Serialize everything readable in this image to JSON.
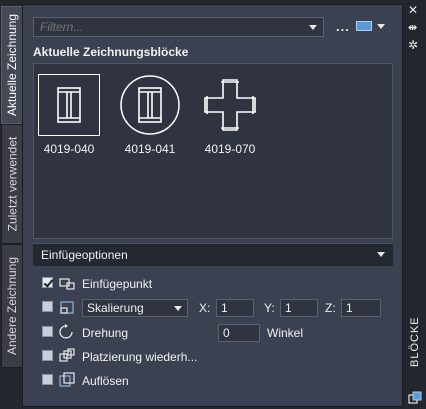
{
  "tabs": [
    {
      "label": "Aktuelle Zeichnung",
      "active": true
    },
    {
      "label": "Zuletzt verwendet",
      "active": false
    },
    {
      "label": "Andere Zeichnung",
      "active": false
    }
  ],
  "filter": {
    "placeholder": "Filtern..."
  },
  "more_label": "...",
  "section_title": "Aktuelle Zeichnungsblöcke",
  "blocks": [
    {
      "label": "4019-040",
      "icon": "i-beam-icon",
      "selected": true
    },
    {
      "label": "4019-041",
      "icon": "i-beam-circle-icon",
      "selected": false
    },
    {
      "label": "4019-070",
      "icon": "cross-icon",
      "selected": false
    }
  ],
  "options": {
    "title": "Einfügeoptionen",
    "insertion_point": {
      "label": "Einfügepunkt",
      "checked": true
    },
    "scale": {
      "mode": "Skalierung",
      "x_label": "X:",
      "x": "1",
      "y_label": "Y:",
      "y": "1",
      "z_label": "Z:",
      "z": "1",
      "checked": false
    },
    "rotation": {
      "label": "Drehung",
      "value": "0",
      "unit": "Winkel",
      "checked": false
    },
    "repeat": {
      "label": "Platzierung wiederh...",
      "checked": false
    },
    "explode": {
      "label": "Auflösen",
      "checked": false
    }
  },
  "palette_title": "BLÖCKE",
  "colors": {
    "panel": "#3b4150",
    "field": "#2f3440",
    "accent": "#5a9ad6"
  }
}
